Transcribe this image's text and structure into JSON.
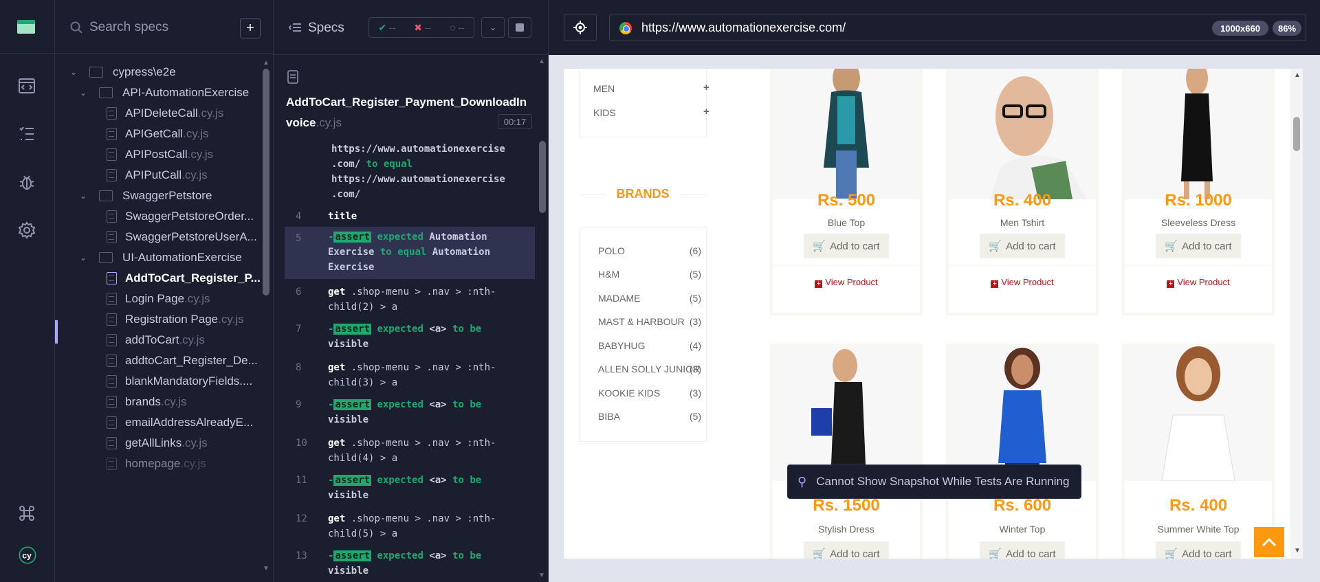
{
  "search": {
    "placeholder": "Search specs"
  },
  "tree": {
    "root": "cypress\\e2e",
    "folders": [
      "API-AutomationExercise",
      "SwaggerPetstore",
      "UI-AutomationExercise"
    ],
    "files": [
      {
        "name": "APIDeleteCall",
        "ext": ".cy.js"
      },
      {
        "name": "APIGetCall",
        "ext": ".cy.js"
      },
      {
        "name": "APIPostCall",
        "ext": ".cy.js"
      },
      {
        "name": "APIPutCall",
        "ext": ".cy.js"
      },
      {
        "name": "SwaggerPetstoreOrder...",
        "ext": ""
      },
      {
        "name": "SwaggerPetstoreUserA...",
        "ext": ""
      },
      {
        "name": "AddToCart_Register_P...",
        "ext": ""
      },
      {
        "name": "Login Page",
        "ext": ".cy.js"
      },
      {
        "name": "Registration Page",
        "ext": ".cy.js"
      },
      {
        "name": "addToCart",
        "ext": ".cy.js"
      },
      {
        "name": "addtoCart_Register_De...",
        "ext": ""
      },
      {
        "name": "blankMandatoryFields....",
        "ext": ""
      },
      {
        "name": "brands",
        "ext": ".cy.js"
      },
      {
        "name": "emailAddressAlreadyE...",
        "ext": ""
      },
      {
        "name": "getAllLinks",
        "ext": ".cy.js"
      },
      {
        "name": "homepage",
        "ext": ".cy.js"
      }
    ]
  },
  "reporter": {
    "specs_label": "Specs",
    "stats": {
      "passed": "--",
      "failed": "--",
      "pending": "--"
    },
    "spec_title": "AddToCart_Register_Payment_DownloadInvoice",
    "spec_ext": ".cy.js",
    "timer": "00:17",
    "log": {
      "l0a": "https://www.automationexercise",
      "l0b": ".com/",
      "l0c": "to equal",
      "l0d": "https://www.automationexercise",
      "l0e": ".com/",
      "n4": "4",
      "c4": "title",
      "n5": "5",
      "c5a": "expected",
      "c5b": "Automation",
      "c5c": "Exercise",
      "c5d": "to equal",
      "c5e": "Automation",
      "c5f": "Exercise",
      "n6": "6",
      "c6a": "get",
      "c6b": ".shop-menu > .nav > :nth-",
      "c6c": "child(2) > a",
      "n7": "7",
      "c7a": "expected",
      "c7b": "<a>",
      "c7c": "to be",
      "c7d": "visible",
      "n8": "8",
      "c8a": "get",
      "c8b": ".shop-menu > .nav > :nth-",
      "c8c": "child(3) > a",
      "n9": "9",
      "c9a": "expected",
      "c9b": "<a>",
      "c9c": "to be",
      "c9d": "visible",
      "n10": "10",
      "c10a": "get",
      "c10b": ".shop-menu > .nav > :nth-",
      "c10c": "child(4) > a",
      "n11": "11",
      "c11a": "expected",
      "c11b": "<a>",
      "c11c": "to be",
      "c11d": "visible",
      "n12": "12",
      "c12a": "get",
      "c12b": ".shop-menu > .nav > :nth-",
      "c12c": "child(5) > a",
      "n13": "13",
      "c13a": "expected",
      "c13b": "<a>",
      "c13c": "to be",
      "c13d": "visible",
      "assert": "assert"
    }
  },
  "browser": {
    "url": "https://www.automationexercise.com/",
    "viewport": "1000x660",
    "zoom": "86%"
  },
  "aut": {
    "categories": [
      "MEN",
      "KIDS"
    ],
    "brands_title": "BRANDS",
    "brands": [
      {
        "name": "POLO",
        "count": "(6)"
      },
      {
        "name": "H&M",
        "count": "(5)"
      },
      {
        "name": "MADAME",
        "count": "(5)"
      },
      {
        "name": "MAST & HARBOUR",
        "count": "(3)"
      },
      {
        "name": "BABYHUG",
        "count": "(4)"
      },
      {
        "name": "ALLEN SOLLY JUNIOR",
        "count": "(3)"
      },
      {
        "name": "KOOKIE KIDS",
        "count": "(3)"
      },
      {
        "name": "BIBA",
        "count": "(5)"
      }
    ],
    "add_to_cart": "Add to cart",
    "view_product": "View Product",
    "products": [
      {
        "price": "Rs. 500",
        "name": "Blue Top"
      },
      {
        "price": "Rs. 400",
        "name": "Men Tshirt"
      },
      {
        "price": "Rs. 1000",
        "name": "Sleeveless Dress"
      },
      {
        "price": "Rs. 1500",
        "name": "Stylish Dress"
      },
      {
        "price": "Rs. 600",
        "name": "Winter Top"
      },
      {
        "price": "Rs. 400",
        "name": "Summer White Top"
      }
    ],
    "toast": "Cannot Show Snapshot While Tests Are Running"
  },
  "colors": {
    "accent": "#fe980f",
    "pass": "#1fa971",
    "fail": "#f0506e",
    "active": "#a7a7ff"
  }
}
